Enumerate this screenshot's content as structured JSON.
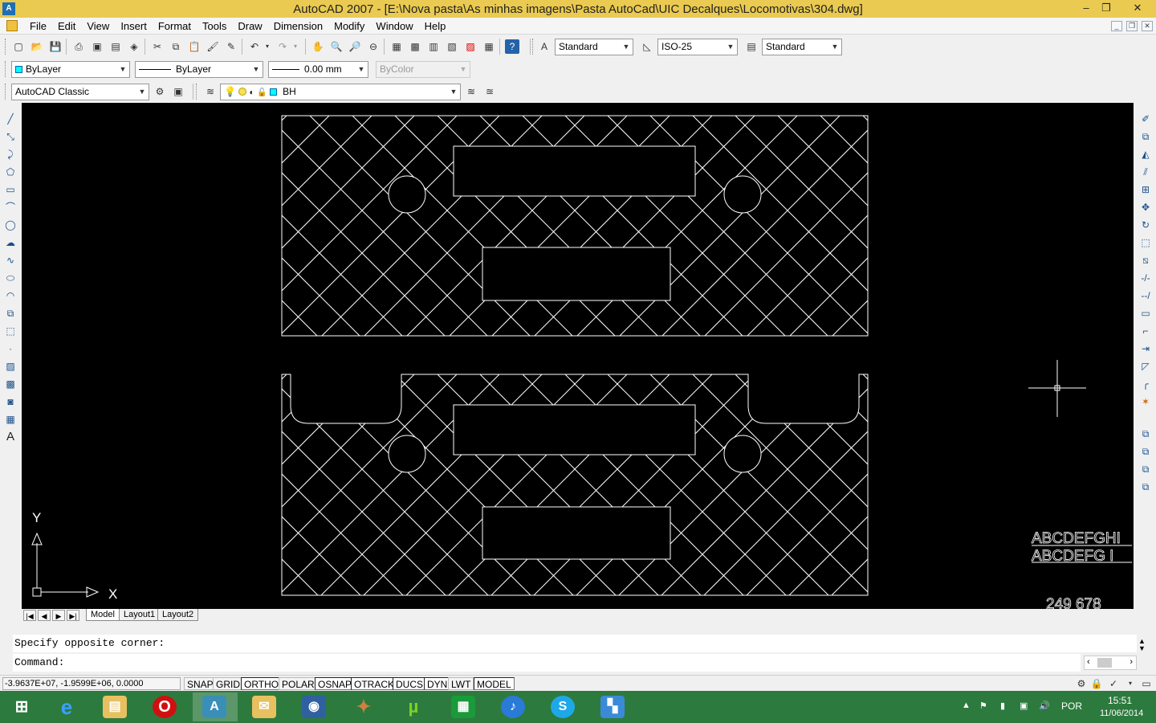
{
  "window": {
    "title": "AutoCAD 2007 - [E:\\Nova pasta\\As minhas imagens\\Pasta AutoCad\\UIC Decalques\\Locomotivas\\304.dwg]",
    "minimize": "–",
    "restore": "❐",
    "close": "✕"
  },
  "menu": {
    "items": [
      "File",
      "Edit",
      "View",
      "Insert",
      "Format",
      "Tools",
      "Draw",
      "Dimension",
      "Modify",
      "Window",
      "Help"
    ]
  },
  "styles_toolbar": {
    "text_style": "Standard",
    "dim_style": "ISO-25",
    "table_style": "Standard"
  },
  "properties_toolbar": {
    "color": "ByLayer",
    "linetype": "ByLayer",
    "lineweight": "0.00 mm",
    "plot_style": "ByColor"
  },
  "workspace": {
    "name": "AutoCAD Classic"
  },
  "layers": {
    "current": "BH"
  },
  "canvas": {
    "text_row1": "ABCDEFGHI",
    "text_row2": "ABCDEFG I",
    "number": "249 678",
    "axis_x": "X",
    "axis_y": "Y"
  },
  "layout_tabs": {
    "tabs": [
      "Model",
      "Layout1",
      "Layout2"
    ],
    "active": "Model"
  },
  "command": {
    "history": "Specify opposite corner:",
    "prompt": "Command:"
  },
  "status": {
    "coords": "-3.9637E+07, -1.9599E+06, 0.0000",
    "toggles": [
      "SNAP",
      "GRID",
      "ORTHO",
      "POLAR",
      "OSNAP",
      "OTRACK",
      "DUCS",
      "DYN",
      "LWT",
      "MODEL"
    ]
  },
  "taskbar": {
    "lang": "POR",
    "time": "15:51",
    "date": "11/06/2014"
  }
}
